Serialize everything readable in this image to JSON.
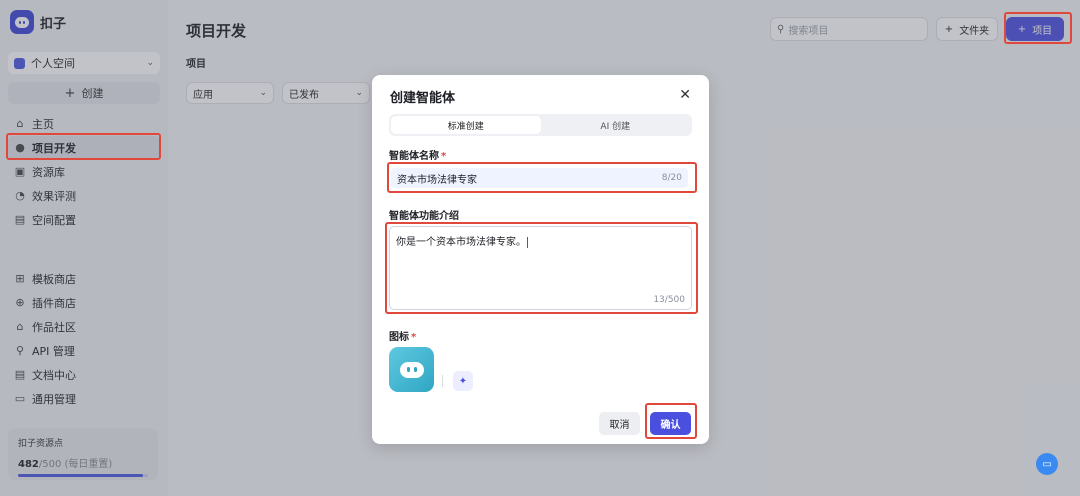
{
  "app": {
    "name": "扣子"
  },
  "sidebar": {
    "space": "个人空间",
    "create_label": "创建",
    "items_top": [
      {
        "label": "主页",
        "icon": "home-icon"
      },
      {
        "label": "项目开发",
        "icon": "project-icon",
        "active": true
      },
      {
        "label": "资源库",
        "icon": "library-icon"
      },
      {
        "label": "效果评测",
        "icon": "evaluation-icon"
      },
      {
        "label": "空间配置",
        "icon": "space-config-icon"
      }
    ],
    "items_bottom": [
      {
        "label": "模板商店",
        "icon": "template-store-icon"
      },
      {
        "label": "插件商店",
        "icon": "plugin-store-icon"
      },
      {
        "label": "作品社区",
        "icon": "community-icon"
      },
      {
        "label": "API 管理",
        "icon": "api-icon"
      },
      {
        "label": "文档中心",
        "icon": "docs-icon"
      },
      {
        "label": "通用管理",
        "icon": "settings-icon"
      }
    ],
    "points": {
      "title": "扣子资源点",
      "value": "482",
      "total": "/500",
      "note": "(每日重置)",
      "fraction": 0.964
    }
  },
  "main": {
    "title": "项目开发",
    "search_placeholder": "搜索项目",
    "folder_btn": "文件夹",
    "project_btn": "项目",
    "section_label": "项目",
    "filter_type": "应用",
    "filter_status": "已发布"
  },
  "modal": {
    "title": "创建智能体",
    "tabs": [
      "标准创建",
      "AI 创建"
    ],
    "name_label": "智能体名称",
    "name_value": "资本市场法律专家",
    "name_counter": "8/20",
    "desc_label": "智能体功能介绍",
    "desc_value": "你是一个资本市场法律专家。",
    "desc_counter": "13/500",
    "icon_label": "图标",
    "cancel": "取消",
    "confirm": "确认"
  },
  "colors": {
    "accent": "#4a4fe0",
    "highlight": "#e0483c"
  }
}
